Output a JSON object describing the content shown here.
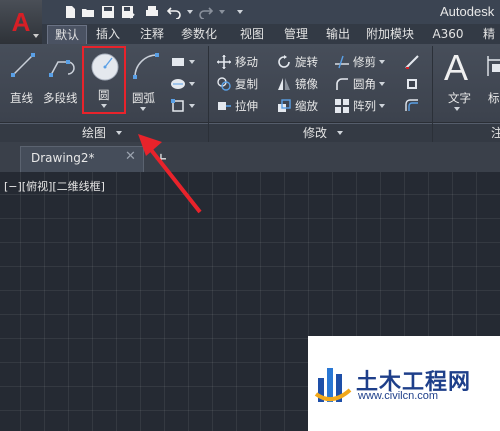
{
  "window": {
    "title": "Autodesk"
  },
  "tabs": [
    "默认",
    "插入",
    "注释",
    "参数化",
    "视图",
    "管理",
    "输出",
    "附加模块",
    "A360",
    "精"
  ],
  "draw_panel": {
    "line": "直线",
    "polyline": "多段线",
    "circle": "圆",
    "arc": "圆弧",
    "title": "绘图"
  },
  "modify_panel": {
    "move": "移动",
    "rotate": "旋转",
    "trim": "修剪",
    "copy": "复制",
    "mirror": "镜像",
    "fillet": "圆角",
    "stretch": "拉伸",
    "scale": "缩放",
    "array": "阵列",
    "title": "修改"
  },
  "annotation_panel": {
    "text": "文字",
    "dimension": "标",
    "title": "注"
  },
  "document": {
    "tab": "Drawing2*",
    "viewport_label": "[−][俯视][二维线框]"
  },
  "watermark": {
    "text": "土木工程网",
    "url": "www.civilcn.com"
  },
  "colors": {
    "highlight": "#e8232b",
    "arrow": "#e8232b",
    "logo": "#d61f26"
  }
}
